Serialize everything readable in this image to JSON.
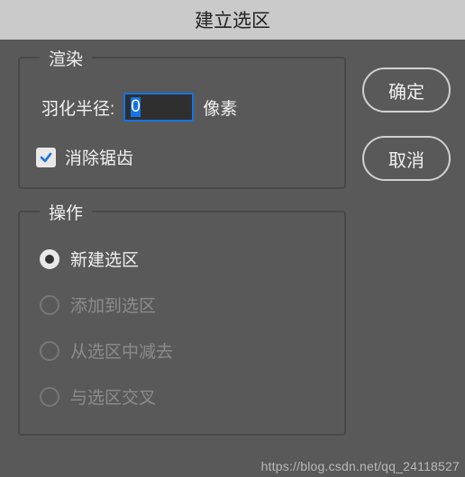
{
  "dialog": {
    "title": "建立选区"
  },
  "render": {
    "legend": "渲染",
    "feather_label": "羽化半径:",
    "feather_value": "0",
    "feather_unit": "像素",
    "antialias_label": "消除锯齿",
    "antialias_checked": true
  },
  "operation": {
    "legend": "操作",
    "options": [
      {
        "label": "新建选区",
        "selected": true,
        "enabled": true
      },
      {
        "label": "添加到选区",
        "selected": false,
        "enabled": false
      },
      {
        "label": "从选区中减去",
        "selected": false,
        "enabled": false
      },
      {
        "label": "与选区交叉",
        "selected": false,
        "enabled": false
      }
    ]
  },
  "buttons": {
    "ok": "确定",
    "cancel": "取消"
  },
  "watermark": "https://blog.csdn.net/qq_24118527"
}
